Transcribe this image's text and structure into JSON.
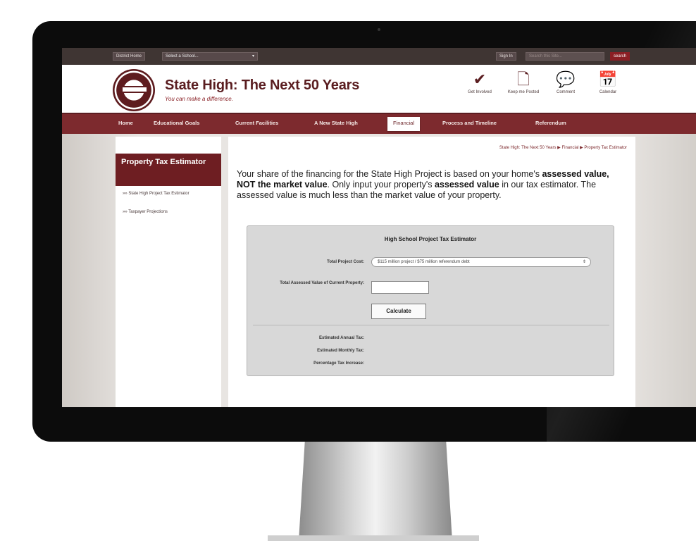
{
  "topbar": {
    "district_home": "District Home",
    "school_select": "Select a School...",
    "sign_in": "Sign In",
    "search_placeholder": "Search this Site...",
    "search_button": "search"
  },
  "header": {
    "title": "State High: The Next 50 Years",
    "tagline": "You can make a difference.",
    "actions": [
      {
        "label": "Get Involved",
        "icon": "checkmark-icon",
        "glyph": "✔"
      },
      {
        "label": "Keep me Posted",
        "icon": "document-icon",
        "glyph": "🗋"
      },
      {
        "label": "Comment",
        "icon": "speech-bubble-icon",
        "glyph": "💬"
      },
      {
        "label": "Calendar",
        "icon": "calendar-icon",
        "glyph": "📅"
      }
    ]
  },
  "nav": {
    "items": [
      "Home",
      "Educational Goals",
      "Current Facilities",
      "A New State High",
      "Financial",
      "Process and Timeline",
      "Referendum"
    ],
    "active": "Financial"
  },
  "sidebar": {
    "heading": "Property Tax Estimator",
    "links": [
      "State High Project Tax Estimator",
      "Taxpayer Projections"
    ]
  },
  "breadcrumb": {
    "text": "State High: The Next 50 Years  ▶  Financial  ▶  Property Tax Estimator"
  },
  "intro": {
    "part1": "Your share of the financing for the State High Project is based on your home's ",
    "bold1": "assessed value, NOT the market value",
    "part2": ". Only input your property's ",
    "bold2": "assessed value",
    "part3": " in our tax estimator. The assessed value is much less than the market value of your property."
  },
  "estimator": {
    "title": "High School Project Tax Estimator",
    "cost_label": "Total Project Cost:",
    "cost_value": "$115 million project / $75 million referendum debt",
    "assessed_label": "Total Assessed Value of Current Property:",
    "assessed_value": "",
    "calculate": "Calculate",
    "annual_label": "Estimated Annual Tax:",
    "monthly_label": "Estimated Monthly Tax:",
    "percent_label": "Percentage Tax Increase:"
  },
  "colors": {
    "maroon": "#7d2a2e",
    "dark_maroon": "#5a1d20",
    "topbar": "#3f3533"
  }
}
